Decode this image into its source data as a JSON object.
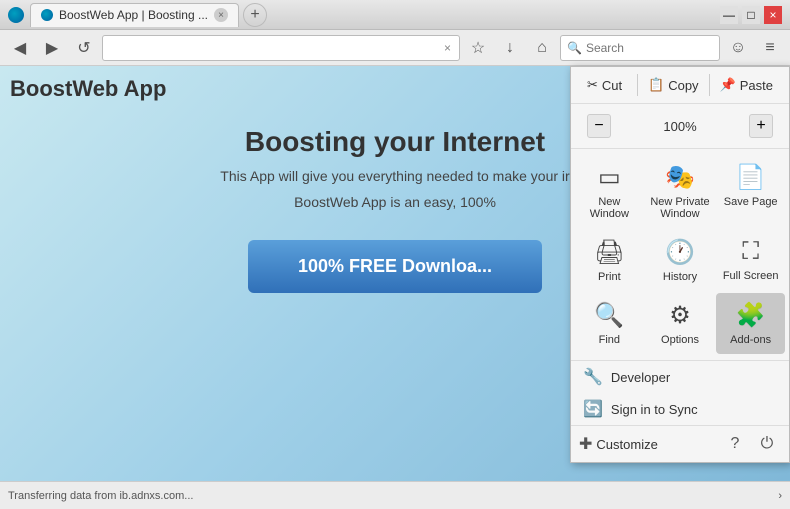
{
  "browser": {
    "title": "BoostWeb App | Boosting ...",
    "tab_close": "×",
    "new_tab_plus": "+",
    "win_min": "—",
    "win_max": "□",
    "win_close": "×"
  },
  "navbar": {
    "back_label": "◀",
    "forward_label": "▶",
    "reload_label": "↺",
    "home_label": "⌂",
    "address_placeholder": "",
    "search_placeholder": "Search",
    "address_clear": "×",
    "bookmark_icon": "☆",
    "download_icon": "↓",
    "home_icon": "⌂",
    "account_icon": "☺",
    "menu_icon": "≡"
  },
  "site": {
    "logo": "BoostWeb App",
    "hero_title": "Boosting your Internet",
    "hero_desc": "This App will give you everything needed to make your ir",
    "hero_desc2": "BoostWeb App is an easy, 100%",
    "cta_label": "100% FREE Downloa..."
  },
  "status_bar": {
    "text": "Transferring data from ib.adnxs.com..."
  },
  "menu": {
    "cut_label": "Cut",
    "copy_label": "Copy",
    "paste_label": "Paste",
    "zoom_minus": "−",
    "zoom_value": "100%",
    "zoom_plus": "+",
    "items": [
      {
        "id": "new-window",
        "icon": "▭",
        "label": "New Window"
      },
      {
        "id": "new-private-window",
        "icon": "🎭",
        "label": "New Private Window"
      },
      {
        "id": "save-page",
        "icon": "📄",
        "label": "Save Page"
      },
      {
        "id": "print",
        "icon": "🖨",
        "label": "Print"
      },
      {
        "id": "history",
        "icon": "🕐",
        "label": "History"
      },
      {
        "id": "full-screen",
        "icon": "⛶",
        "label": "Full Screen"
      },
      {
        "id": "find",
        "icon": "🔍",
        "label": "Find"
      },
      {
        "id": "options",
        "icon": "⚙",
        "label": "Options"
      },
      {
        "id": "add-ons",
        "icon": "🧩",
        "label": "Add-ons"
      }
    ],
    "developer_label": "Developer",
    "developer_icon": "🔧",
    "sign_in_label": "Sign in to Sync",
    "sign_in_icon": "🔄",
    "customize_label": "Customize",
    "customize_icon": "✚",
    "help_icon": "?",
    "power_icon": "⏻"
  }
}
